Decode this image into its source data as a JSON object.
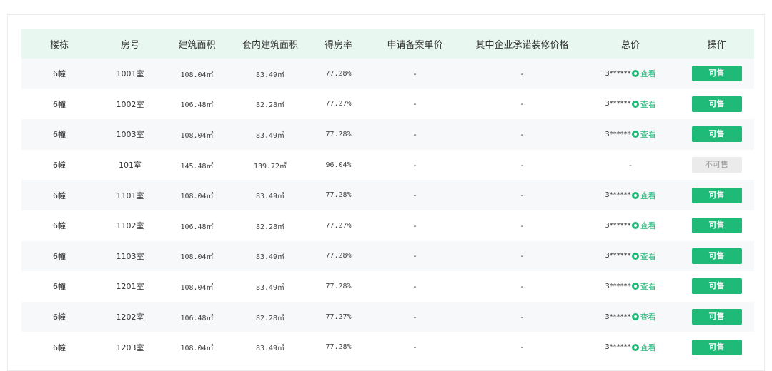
{
  "table": {
    "columns": [
      "楼栋",
      "房号",
      "建筑面积",
      "套内建筑面积",
      "得房率",
      "申请备案单价",
      "其中企业承诺装修价格",
      "总价",
      "操作"
    ],
    "view_label": "查看",
    "rows": [
      {
        "building": "6幢",
        "room": "1001室",
        "area": "108.04㎡",
        "inner_area": "83.49㎡",
        "ratio": "77.28%",
        "unit_price": "-",
        "decor_price": "-",
        "total": "3******",
        "has_view": true,
        "action": "可售",
        "available": true
      },
      {
        "building": "6幢",
        "room": "1002室",
        "area": "106.48㎡",
        "inner_area": "82.28㎡",
        "ratio": "77.27%",
        "unit_price": "-",
        "decor_price": "-",
        "total": "3******",
        "has_view": true,
        "action": "可售",
        "available": true
      },
      {
        "building": "6幢",
        "room": "1003室",
        "area": "108.04㎡",
        "inner_area": "83.49㎡",
        "ratio": "77.28%",
        "unit_price": "-",
        "decor_price": "-",
        "total": "3******",
        "has_view": true,
        "action": "可售",
        "available": true
      },
      {
        "building": "6幢",
        "room": "101室",
        "area": "145.48㎡",
        "inner_area": "139.72㎡",
        "ratio": "96.04%",
        "unit_price": "-",
        "decor_price": "-",
        "total": "-",
        "has_view": false,
        "action": "不可售",
        "available": false
      },
      {
        "building": "6幢",
        "room": "1101室",
        "area": "108.04㎡",
        "inner_area": "83.49㎡",
        "ratio": "77.28%",
        "unit_price": "-",
        "decor_price": "-",
        "total": "3******",
        "has_view": true,
        "action": "可售",
        "available": true
      },
      {
        "building": "6幢",
        "room": "1102室",
        "area": "106.48㎡",
        "inner_area": "82.28㎡",
        "ratio": "77.27%",
        "unit_price": "-",
        "decor_price": "-",
        "total": "3******",
        "has_view": true,
        "action": "可售",
        "available": true
      },
      {
        "building": "6幢",
        "room": "1103室",
        "area": "108.04㎡",
        "inner_area": "83.49㎡",
        "ratio": "77.28%",
        "unit_price": "-",
        "decor_price": "-",
        "total": "3******",
        "has_view": true,
        "action": "可售",
        "available": true
      },
      {
        "building": "6幢",
        "room": "1201室",
        "area": "108.04㎡",
        "inner_area": "83.49㎡",
        "ratio": "77.28%",
        "unit_price": "-",
        "decor_price": "-",
        "total": "3******",
        "has_view": true,
        "action": "可售",
        "available": true
      },
      {
        "building": "6幢",
        "room": "1202室",
        "area": "106.48㎡",
        "inner_area": "82.28㎡",
        "ratio": "77.27%",
        "unit_price": "-",
        "decor_price": "-",
        "total": "3******",
        "has_view": true,
        "action": "可售",
        "available": true
      },
      {
        "building": "6幢",
        "room": "1203室",
        "area": "108.04㎡",
        "inner_area": "83.49㎡",
        "ratio": "77.28%",
        "unit_price": "-",
        "decor_price": "-",
        "total": "3******",
        "has_view": true,
        "action": "可售",
        "available": true
      }
    ]
  },
  "colors": {
    "accent": "#1fb978",
    "header_bg": "#e8f7f0",
    "disabled_bg": "#ebebeb"
  },
  "icons": {
    "view": "eye-icon"
  }
}
